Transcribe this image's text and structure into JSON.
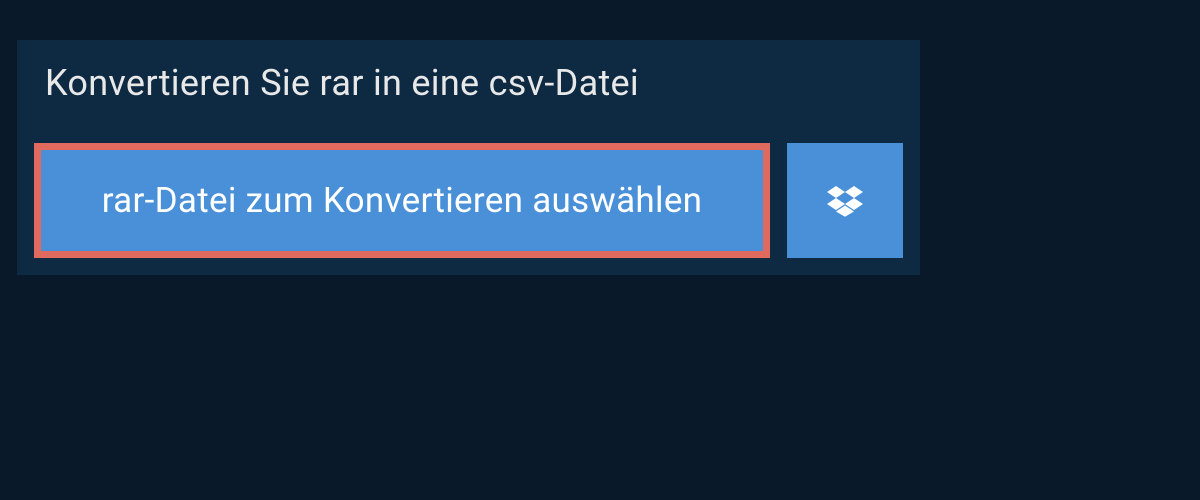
{
  "title": "Konvertieren Sie rar in eine csv-Datei",
  "select_button_label": "rar-Datei zum Konvertieren auswählen"
}
